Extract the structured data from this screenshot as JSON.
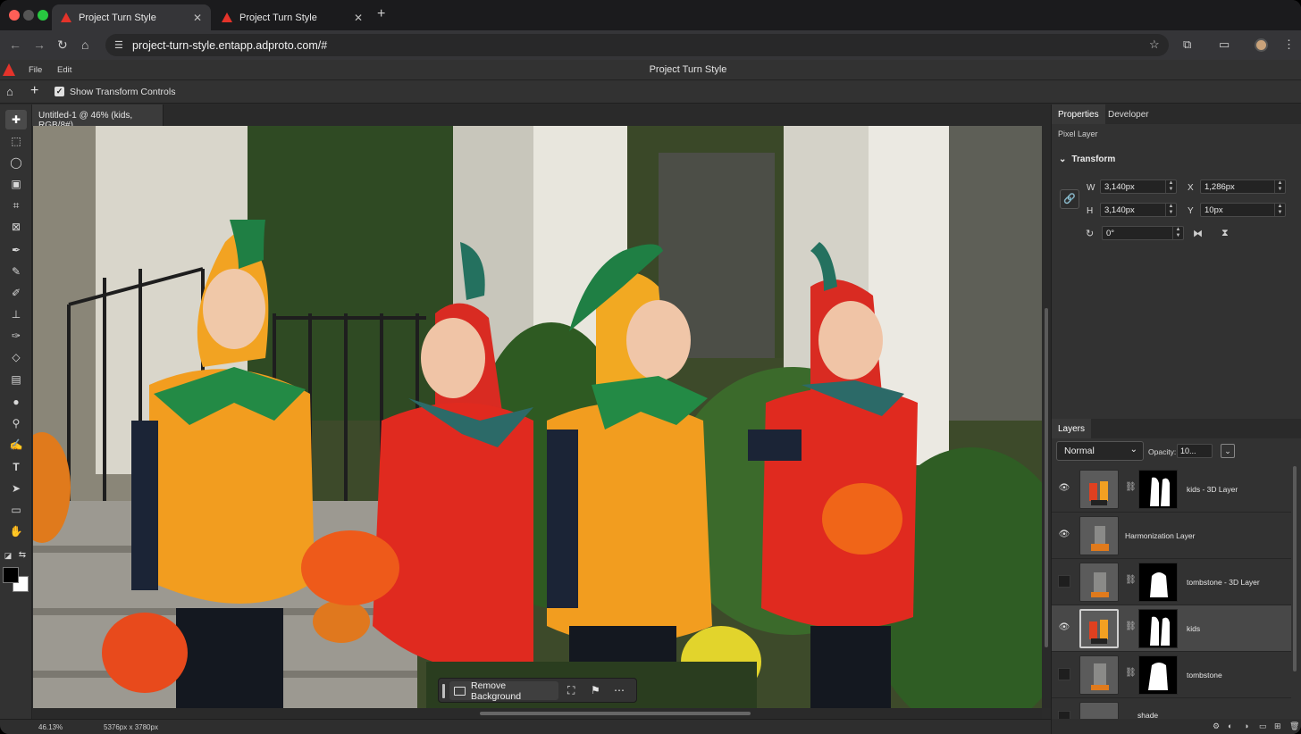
{
  "browser": {
    "tabs": [
      {
        "title": "Project Turn Style",
        "active": true
      },
      {
        "title": "Project Turn Style",
        "active": false
      }
    ],
    "url": "project-turn-style.entapp.adproto.com/#"
  },
  "app": {
    "menu": {
      "file": "File",
      "edit": "Edit"
    },
    "title": "Project Turn Style",
    "options": {
      "show_transform_controls": "Show Transform Controls",
      "checked": true
    }
  },
  "document": {
    "tab_title": "Untitled-1 @ 46% (kids, RGB/8#)",
    "status_zoom": "46.13%",
    "status_size": "5376px x 3780px"
  },
  "taskbar": {
    "remove_background": "Remove Background"
  },
  "properties": {
    "tabs": [
      "Properties",
      "Developer"
    ],
    "layer_type": "Pixel Layer",
    "section": "Transform",
    "w_label": "W",
    "w_value": "3,140px",
    "h_label": "H",
    "h_value": "3,140px",
    "x_label": "X",
    "x_value": "1,286px",
    "y_label": "Y",
    "y_value": "10px",
    "rotation_value": "0°"
  },
  "layers": {
    "tab": "Layers",
    "blend_mode": "Normal",
    "opacity_label": "Opacity:",
    "opacity_value": "10...",
    "items": [
      {
        "name": "kids - 3D Layer",
        "visible": true,
        "selected": false
      },
      {
        "name": "Harmonization Layer",
        "visible": true,
        "selected": false
      },
      {
        "name": "tombstone - 3D Layer",
        "visible": false,
        "selected": false
      },
      {
        "name": "kids",
        "visible": true,
        "selected": true
      },
      {
        "name": "tombstone",
        "visible": false,
        "selected": false
      },
      {
        "name": "shade",
        "visible": false,
        "selected": false
      }
    ]
  },
  "colors": {
    "accent": "#e4332a",
    "panel": "#323232",
    "selected_row": "#484848"
  }
}
